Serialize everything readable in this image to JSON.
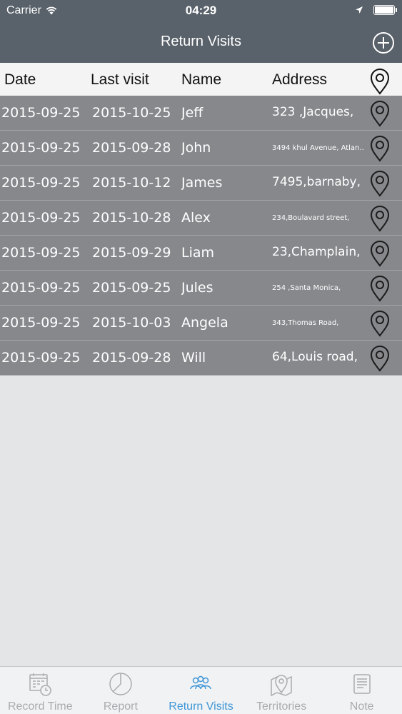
{
  "status_bar": {
    "carrier": "Carrier",
    "time": "04:29"
  },
  "nav": {
    "title": "Return Visits"
  },
  "table": {
    "headers": {
      "date": "Date",
      "last_visit": "Last visit",
      "name": "Name",
      "address": "Address"
    },
    "rows": [
      {
        "date": "2015-09-25",
        "last_visit": "2015-10-25",
        "name": "Jeff",
        "address": "323 ,Jacques,",
        "small": false
      },
      {
        "date": "2015-09-25",
        "last_visit": "2015-09-28",
        "name": "John",
        "address": "3494 khul Avenue, Atlan...",
        "small": true
      },
      {
        "date": "2015-09-25",
        "last_visit": "2015-10-12",
        "name": "James",
        "address": "7495,barnaby,",
        "small": false
      },
      {
        "date": "2015-09-25",
        "last_visit": "2015-10-28",
        "name": "Alex",
        "address": "234,Boulavard street,",
        "small": true
      },
      {
        "date": "2015-09-25",
        "last_visit": "2015-09-29",
        "name": "Liam",
        "address": "23,Champlain,",
        "small": false
      },
      {
        "date": "2015-09-25",
        "last_visit": "2015-09-25",
        "name": "Jules",
        "address": "254 ,Santa Monica,",
        "small": true
      },
      {
        "date": "2015-09-25",
        "last_visit": "2015-10-03",
        "name": "Angela",
        "address": "343,Thomas Road,",
        "small": true
      },
      {
        "date": "2015-09-25",
        "last_visit": "2015-09-28",
        "name": "Will",
        "address": "64,Louis road,",
        "small": false
      }
    ]
  },
  "tabs": [
    {
      "label": "Record Time",
      "icon": "calendar-clock-icon",
      "active": false
    },
    {
      "label": "Report",
      "icon": "pie-chart-icon",
      "active": false
    },
    {
      "label": "Return Visits",
      "icon": "people-icon",
      "active": true
    },
    {
      "label": "Territories",
      "icon": "map-pin-icon",
      "active": false
    },
    {
      "label": "Note",
      "icon": "note-icon",
      "active": false
    }
  ],
  "colors": {
    "nav_bg": "#59616a",
    "row_bg": "#86888b",
    "header_bg": "#f4f4f5",
    "active_tab": "#3d96d8",
    "inactive_tab": "#a9abae"
  }
}
